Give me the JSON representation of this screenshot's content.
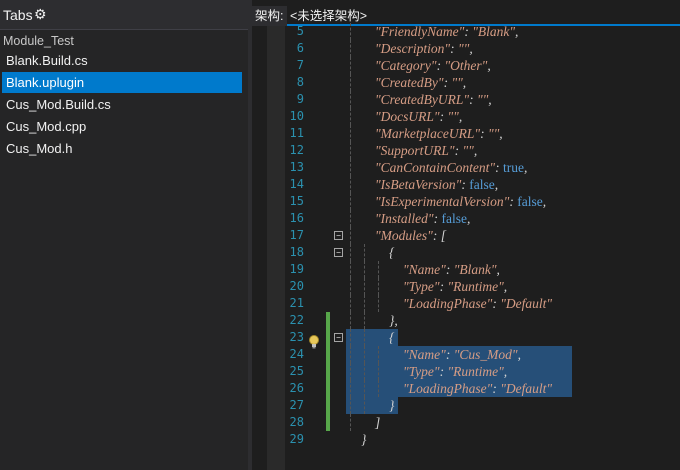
{
  "tabs_panel": {
    "title": "Tabs",
    "gear_glyph": "⚙",
    "group_label": "Module_Test",
    "files": [
      {
        "label": "Blank.Build.cs",
        "selected": false
      },
      {
        "label": "Blank.uplugin",
        "selected": true
      },
      {
        "label": "Cus_Mod.Build.cs",
        "selected": false
      },
      {
        "label": "Cus_Mod.cpp",
        "selected": false
      },
      {
        "label": "Cus_Mod.h",
        "selected": false
      }
    ]
  },
  "editor": {
    "nav": {
      "label": "架构:",
      "dropdown_value": "<未选择架构>"
    },
    "colors": {
      "accent": "#007acc",
      "string": "#d69d85",
      "keyword": "#569cd6",
      "line_number": "#2b91af",
      "change_bar": "#57a64a",
      "selection": "#264f78"
    },
    "lines": [
      {
        "num": "5",
        "indent": 1,
        "parts": [
          [
            "str",
            "\"FriendlyName\""
          ],
          [
            "t",
            ": "
          ],
          [
            "str",
            "\"Blank\""
          ],
          [
            "t",
            ","
          ]
        ]
      },
      {
        "num": "6",
        "indent": 1,
        "parts": [
          [
            "str",
            "\"Description\""
          ],
          [
            "t",
            ": "
          ],
          [
            "str",
            "\"\""
          ],
          [
            "t",
            ","
          ]
        ]
      },
      {
        "num": "7",
        "indent": 1,
        "parts": [
          [
            "str",
            "\"Category\""
          ],
          [
            "t",
            ": "
          ],
          [
            "str",
            "\"Other\""
          ],
          [
            "t",
            ","
          ]
        ]
      },
      {
        "num": "8",
        "indent": 1,
        "parts": [
          [
            "str",
            "\"CreatedBy\""
          ],
          [
            "t",
            ": "
          ],
          [
            "str",
            "\"\""
          ],
          [
            "t",
            ","
          ]
        ]
      },
      {
        "num": "9",
        "indent": 1,
        "parts": [
          [
            "str",
            "\"CreatedByURL\""
          ],
          [
            "t",
            ": "
          ],
          [
            "str",
            "\"\""
          ],
          [
            "t",
            ","
          ]
        ]
      },
      {
        "num": "10",
        "indent": 1,
        "parts": [
          [
            "str",
            "\"DocsURL\""
          ],
          [
            "t",
            ": "
          ],
          [
            "str",
            "\"\""
          ],
          [
            "t",
            ","
          ]
        ]
      },
      {
        "num": "11",
        "indent": 1,
        "parts": [
          [
            "str",
            "\"MarketplaceURL\""
          ],
          [
            "t",
            ": "
          ],
          [
            "str",
            "\"\""
          ],
          [
            "t",
            ","
          ]
        ]
      },
      {
        "num": "12",
        "indent": 1,
        "parts": [
          [
            "str",
            "\"SupportURL\""
          ],
          [
            "t",
            ": "
          ],
          [
            "str",
            "\"\""
          ],
          [
            "t",
            ","
          ]
        ]
      },
      {
        "num": "13",
        "indent": 1,
        "parts": [
          [
            "str",
            "\"CanContainContent\""
          ],
          [
            "t",
            ": "
          ],
          [
            "kw",
            "true"
          ],
          [
            "t",
            ","
          ]
        ]
      },
      {
        "num": "14",
        "indent": 1,
        "parts": [
          [
            "str",
            "\"IsBetaVersion\""
          ],
          [
            "t",
            ": "
          ],
          [
            "kw",
            "false"
          ],
          [
            "t",
            ","
          ]
        ]
      },
      {
        "num": "15",
        "indent": 1,
        "parts": [
          [
            "str",
            "\"IsExperimentalVersion\""
          ],
          [
            "t",
            ": "
          ],
          [
            "kw",
            "false"
          ],
          [
            "t",
            ","
          ]
        ]
      },
      {
        "num": "16",
        "indent": 1,
        "parts": [
          [
            "str",
            "\"Installed\""
          ],
          [
            "t",
            ": "
          ],
          [
            "kw",
            "false"
          ],
          [
            "t",
            ","
          ]
        ]
      },
      {
        "num": "17",
        "indent": 1,
        "fold": true,
        "parts": [
          [
            "str",
            "\"Modules\""
          ],
          [
            "t",
            ": ["
          ]
        ]
      },
      {
        "num": "18",
        "indent": 2,
        "fold": true,
        "parts": [
          [
            "t",
            "{"
          ]
        ]
      },
      {
        "num": "19",
        "indent": 3,
        "parts": [
          [
            "str",
            "\"Name\""
          ],
          [
            "t",
            ": "
          ],
          [
            "str",
            "\"Blank\""
          ],
          [
            "t",
            ","
          ]
        ]
      },
      {
        "num": "20",
        "indent": 3,
        "parts": [
          [
            "str",
            "\"Type\""
          ],
          [
            "t",
            ": "
          ],
          [
            "str",
            "\"Runtime\""
          ],
          [
            "t",
            ","
          ]
        ]
      },
      {
        "num": "21",
        "indent": 3,
        "parts": [
          [
            "str",
            "\"LoadingPhase\""
          ],
          [
            "t",
            ": "
          ],
          [
            "str",
            "\"Default\""
          ]
        ]
      },
      {
        "num": "22",
        "indent": 2,
        "changed": true,
        "parts": [
          [
            "t",
            "},"
          ]
        ]
      },
      {
        "num": "23",
        "indent": 2,
        "changed": true,
        "fold": true,
        "bulb": true,
        "selected": "partial",
        "parts": [
          [
            "t",
            "{"
          ]
        ]
      },
      {
        "num": "24",
        "indent": 3,
        "changed": true,
        "selected": "full",
        "parts": [
          [
            "str",
            "\"Name\""
          ],
          [
            "t",
            ": "
          ],
          [
            "str",
            "\"Cus_Mod\""
          ],
          [
            "t",
            ","
          ]
        ]
      },
      {
        "num": "25",
        "indent": 3,
        "changed": true,
        "selected": "full",
        "parts": [
          [
            "str",
            "\"Type\""
          ],
          [
            "t",
            ": "
          ],
          [
            "str",
            "\"Runtime\""
          ],
          [
            "t",
            ","
          ]
        ]
      },
      {
        "num": "26",
        "indent": 3,
        "changed": true,
        "selected": "full",
        "parts": [
          [
            "str",
            "\"LoadingPhase\""
          ],
          [
            "t",
            ": "
          ],
          [
            "str",
            "\"Default\""
          ]
        ]
      },
      {
        "num": "27",
        "indent": 2,
        "changed": true,
        "selected": "partial",
        "parts": [
          [
            "t",
            "}"
          ]
        ]
      },
      {
        "num": "28",
        "indent": 1,
        "changed": true,
        "parts": [
          [
            "t",
            "]"
          ]
        ]
      },
      {
        "num": "29",
        "indent": 0,
        "parts": [
          [
            "t",
            "}"
          ]
        ]
      }
    ]
  }
}
